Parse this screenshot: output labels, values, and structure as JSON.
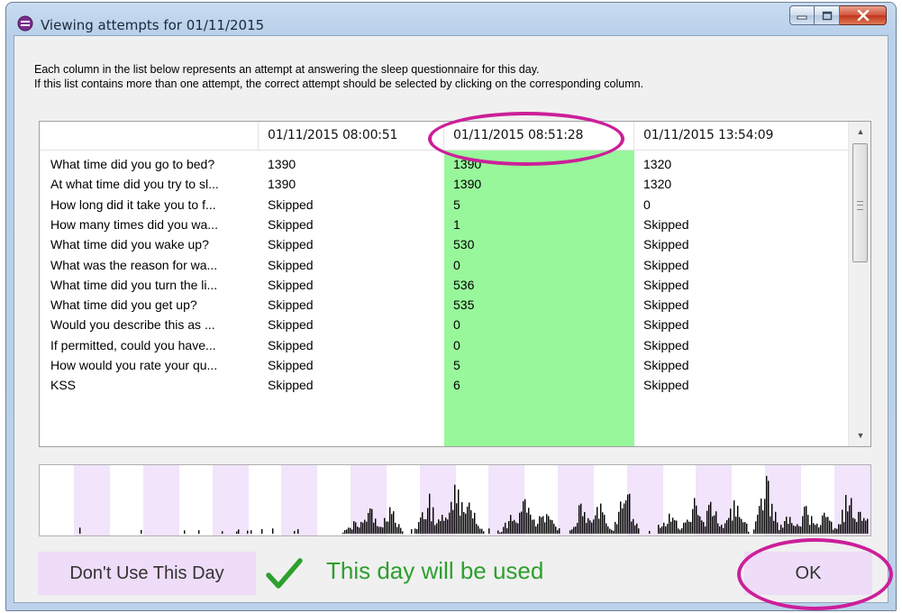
{
  "window": {
    "title": "Viewing attempts for 01/11/2015",
    "controls": [
      "minimize-icon",
      "maximize-icon",
      "close-icon"
    ]
  },
  "instructions": {
    "line1": "Each column in the list below represents an attempt at answering the sleep questionnaire for this day.",
    "line2": "If this list contains more than one attempt, the correct attempt should be selected by clicking on the corresponding column."
  },
  "grid": {
    "headers": [
      "",
      "01/11/2015 08:00:51",
      "01/11/2015 08:51:28",
      "01/11/2015 13:54:09"
    ],
    "selected_column": 2,
    "highlight_color": "#98f79a",
    "rows": [
      [
        "What time did you go to bed?",
        "1390",
        "1390",
        "1320"
      ],
      [
        "At what time did you try to sl...",
        "1390",
        "1390",
        "1320"
      ],
      [
        "How long did it take you to f...",
        "Skipped",
        "5",
        "0"
      ],
      [
        "How many times did you wa...",
        "Skipped",
        "1",
        "Skipped"
      ],
      [
        "What time did you wake up?",
        "Skipped",
        "530",
        "Skipped"
      ],
      [
        "What was the reason for wa...",
        "Skipped",
        "0",
        "Skipped"
      ],
      [
        "What time did you turn the li...",
        "Skipped",
        "536",
        "Skipped"
      ],
      [
        "What time did you get up?",
        "Skipped",
        "535",
        "Skipped"
      ],
      [
        "Would you describe this as ...",
        "Skipped",
        "0",
        "Skipped"
      ],
      [
        "If permitted, could you have...",
        "Skipped",
        "0",
        "Skipped"
      ],
      [
        "How would you rate your qu...",
        "Skipped",
        "5",
        "Skipped"
      ],
      [
        "KSS",
        "Skipped",
        "6",
        "Skipped"
      ]
    ]
  },
  "activity_chart": {
    "band_color": "#f1e4fb",
    "bar_color": "#000000"
  },
  "footer": {
    "dont_use_label": "Don't Use This Day",
    "status_text": "This day will be used",
    "status_icon": "checkmark-icon",
    "status_color": "#2ca02c",
    "ok_label": "OK",
    "button_color": "#eedcf8"
  },
  "annotations": {
    "color": "#cc1f9a"
  }
}
